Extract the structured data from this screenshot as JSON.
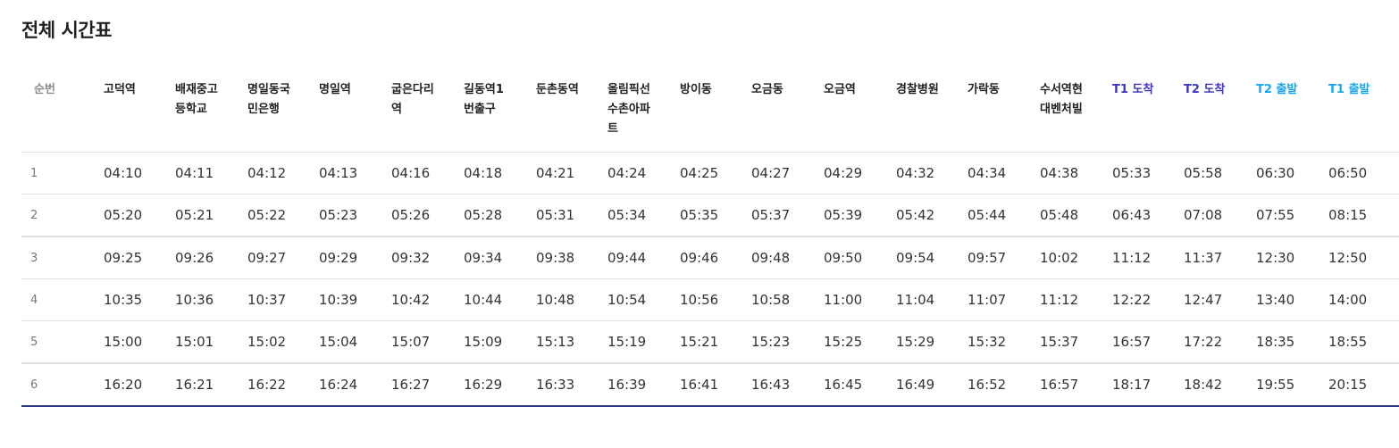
{
  "page": {
    "title": "전체 시간표"
  },
  "columns": [
    {
      "key": "order",
      "lines": [
        "순번"
      ]
    },
    {
      "key": "s1",
      "lines": [
        "고덕역"
      ]
    },
    {
      "key": "s2",
      "lines": [
        "배재중고",
        "등학교"
      ]
    },
    {
      "key": "s3",
      "lines": [
        "명일동국",
        "민은행"
      ]
    },
    {
      "key": "s4",
      "lines": [
        "명일역"
      ]
    },
    {
      "key": "s5",
      "lines": [
        "굽은다리",
        "역"
      ]
    },
    {
      "key": "s6",
      "lines": [
        "길동역1",
        "번출구"
      ]
    },
    {
      "key": "s7",
      "lines": [
        "둔촌동역"
      ]
    },
    {
      "key": "s8",
      "lines": [
        "올림픽선",
        "수촌아파",
        "트"
      ]
    },
    {
      "key": "s9",
      "lines": [
        "방이동"
      ]
    },
    {
      "key": "s10",
      "lines": [
        "오금동"
      ]
    },
    {
      "key": "s11",
      "lines": [
        "오금역"
      ]
    },
    {
      "key": "s12",
      "lines": [
        "경찰병원"
      ]
    },
    {
      "key": "s13",
      "lines": [
        "가락동"
      ]
    },
    {
      "key": "s14",
      "lines": [
        "수서역현",
        "대벤처빌"
      ]
    },
    {
      "key": "t1_arr",
      "lines": [
        "T1 도착"
      ]
    },
    {
      "key": "t2_arr",
      "lines": [
        "T2 도착"
      ]
    },
    {
      "key": "t2_dep",
      "lines": [
        "T2 출발"
      ]
    },
    {
      "key": "t1_dep",
      "lines": [
        "T1 출발"
      ]
    }
  ],
  "colors": {
    "arrival": "#3d35c7",
    "departure": "#1aa7ee",
    "bottom_border": "#2e3a82",
    "order_text": "#8a8a8a"
  },
  "rows": [
    [
      "1",
      "04:10",
      "04:11",
      "04:12",
      "04:13",
      "04:16",
      "04:18",
      "04:21",
      "04:24",
      "04:25",
      "04:27",
      "04:29",
      "04:32",
      "04:34",
      "04:38",
      "05:33",
      "05:58",
      "06:30",
      "06:50"
    ],
    [
      "2",
      "05:20",
      "05:21",
      "05:22",
      "05:23",
      "05:26",
      "05:28",
      "05:31",
      "05:34",
      "05:35",
      "05:37",
      "05:39",
      "05:42",
      "05:44",
      "05:48",
      "06:43",
      "07:08",
      "07:55",
      "08:15"
    ],
    [
      "3",
      "09:25",
      "09:26",
      "09:27",
      "09:29",
      "09:32",
      "09:34",
      "09:38",
      "09:44",
      "09:46",
      "09:48",
      "09:50",
      "09:54",
      "09:57",
      "10:02",
      "11:12",
      "11:37",
      "12:30",
      "12:50"
    ],
    [
      "4",
      "10:35",
      "10:36",
      "10:37",
      "10:39",
      "10:42",
      "10:44",
      "10:48",
      "10:54",
      "10:56",
      "10:58",
      "11:00",
      "11:04",
      "11:07",
      "11:12",
      "12:22",
      "12:47",
      "13:40",
      "14:00"
    ],
    [
      "5",
      "15:00",
      "15:01",
      "15:02",
      "15:04",
      "15:07",
      "15:09",
      "15:13",
      "15:19",
      "15:21",
      "15:23",
      "15:25",
      "15:29",
      "15:32",
      "15:37",
      "16:57",
      "17:22",
      "18:35",
      "18:55"
    ],
    [
      "6",
      "16:20",
      "16:21",
      "16:22",
      "16:24",
      "16:27",
      "16:29",
      "16:33",
      "16:39",
      "16:41",
      "16:43",
      "16:45",
      "16:49",
      "16:52",
      "16:57",
      "18:17",
      "18:42",
      "19:55",
      "20:15"
    ]
  ]
}
